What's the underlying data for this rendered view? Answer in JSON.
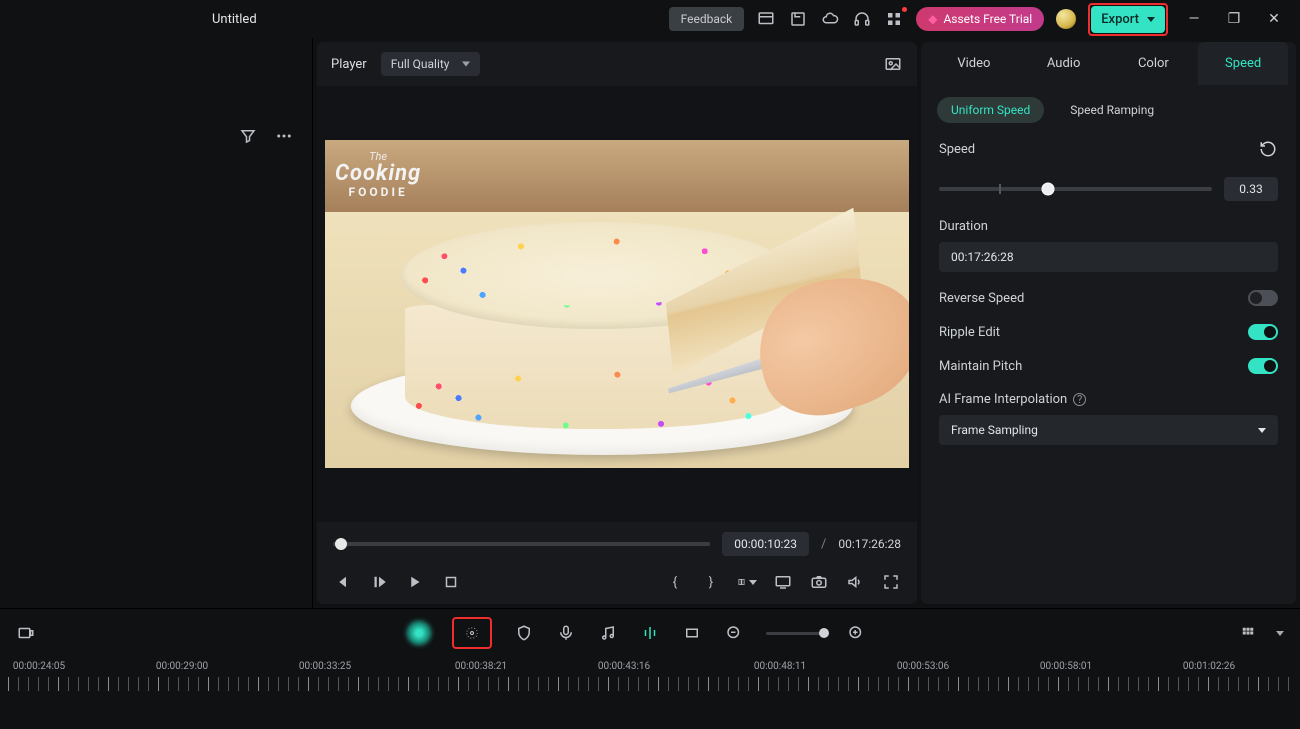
{
  "titlebar": {
    "title": "Untitled",
    "feedback_label": "Feedback",
    "assets_label": "Assets Free Trial",
    "export_label": "Export"
  },
  "player": {
    "label": "Player",
    "quality": "Full Quality",
    "current_time": "00:00:10:23",
    "total_time": "00:17:26:28",
    "logo_line1": "The",
    "logo_line2": "Cooking",
    "logo_line3": "FOODIE"
  },
  "right_panel": {
    "tabs": {
      "video": "Video",
      "audio": "Audio",
      "color": "Color",
      "speed": "Speed"
    },
    "subtabs": {
      "uniform": "Uniform Speed",
      "ramping": "Speed Ramping"
    },
    "speed_label": "Speed",
    "speed_value": "0.33",
    "duration_label": "Duration",
    "duration_value": "00:17:26:28",
    "reverse_label": "Reverse Speed",
    "ripple_label": "Ripple Edit",
    "pitch_label": "Maintain Pitch",
    "ai_label": "AI Frame Interpolation",
    "ai_value": "Frame Sampling"
  },
  "timeline": {
    "labels": [
      "00:00:24:05",
      "00:00:29:00",
      "00:00:33:25",
      "00:00:38:21",
      "00:00:43:16",
      "00:00:48:11",
      "00:00:53:06",
      "00:00:58:01",
      "00:01:02:26"
    ]
  }
}
